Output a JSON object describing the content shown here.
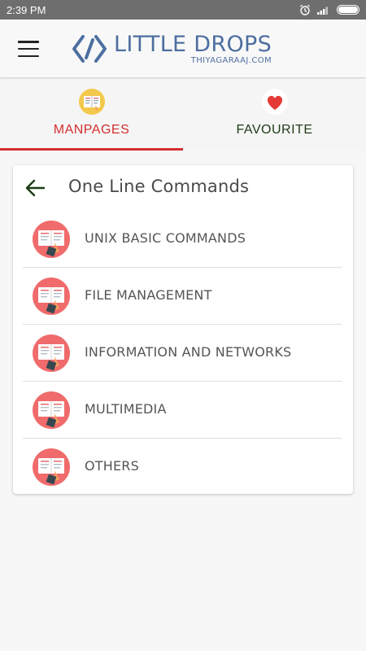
{
  "status_bar": {
    "time": "2:39 PM"
  },
  "app_bar": {
    "logo_title": "LITTLE DROPS",
    "logo_subtitle": "THIYAGARAAJ.COM"
  },
  "tabs": [
    {
      "label": "MANPAGES",
      "icon": "manpages-icon",
      "active": true
    },
    {
      "label": "FAVOURITE",
      "icon": "heart-icon",
      "active": false
    }
  ],
  "card": {
    "title": "One Line Commands",
    "items": [
      {
        "label": "UNIX BASIC COMMANDS",
        "icon": "book-icon"
      },
      {
        "label": "FILE MANAGEMENT",
        "icon": "book-icon"
      },
      {
        "label": "INFORMATION AND NETWORKS",
        "icon": "book-icon"
      },
      {
        "label": "MULTIMEDIA",
        "icon": "book-icon"
      },
      {
        "label": "OTHERS",
        "icon": "book-icon"
      }
    ]
  },
  "colors": {
    "accent": "#d32f2f",
    "logo": "#4d6fa0",
    "status_bar": "#6e6e6e",
    "icon_bg": "#f06b6b"
  }
}
